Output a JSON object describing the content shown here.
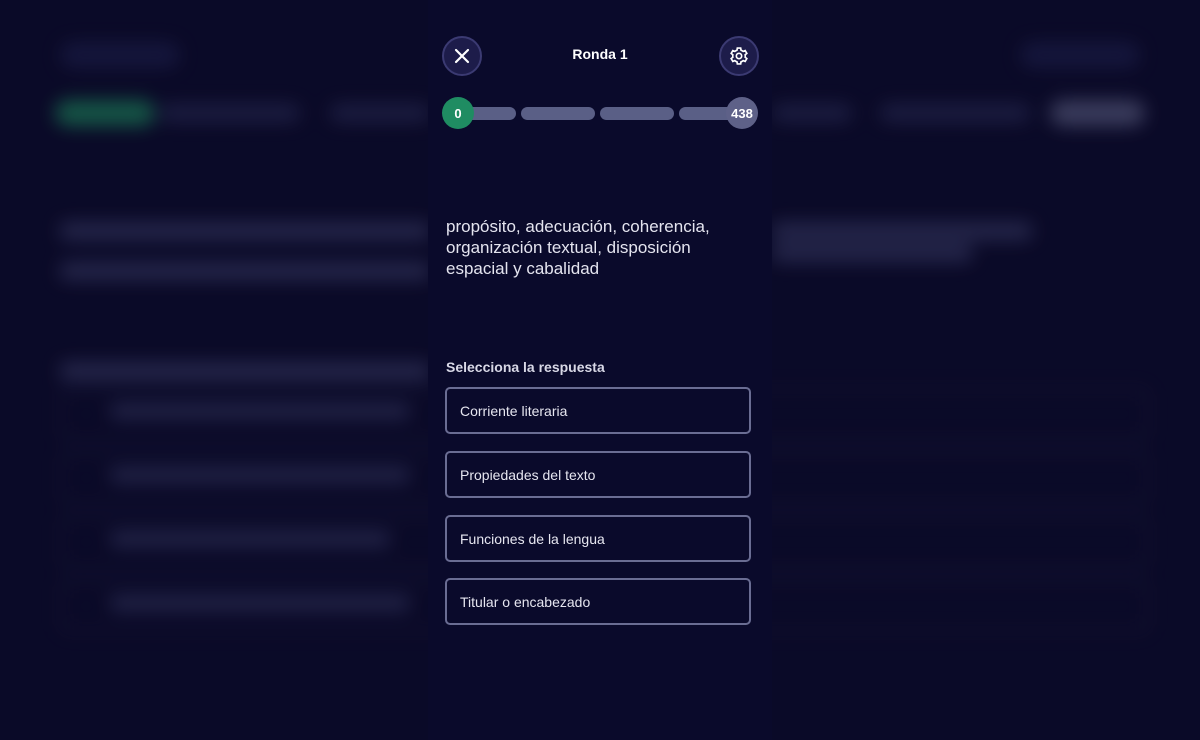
{
  "header": {
    "round_title": "Ronda 1",
    "close_icon": "close-icon",
    "settings_icon": "gear-icon"
  },
  "progress": {
    "player_score": "0",
    "target_score": "438",
    "segments": 4,
    "player_color": "#1f8c62",
    "track_color": "#5a5f86"
  },
  "question": {
    "text": "propósito, adecuación, coherencia, organización textual, disposición espacial y cabalidad"
  },
  "answers": {
    "instruction": "Selecciona la respuesta",
    "options": [
      "Corriente literaria",
      "Propiedades del texto",
      "Funciones de la lengua",
      "Titular o encabezado"
    ]
  },
  "colors": {
    "background": "#0c0b2e",
    "panel": "#0a0a2b",
    "option_border": "#6a6d93"
  }
}
